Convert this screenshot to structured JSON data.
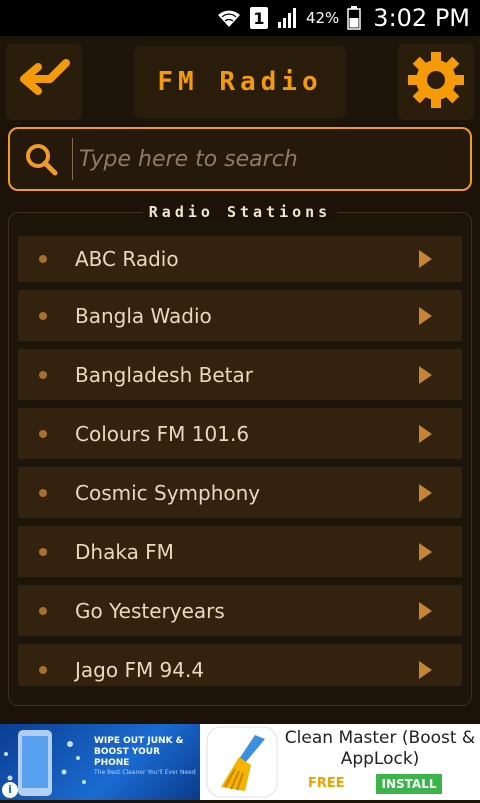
{
  "status_bar": {
    "sim_label": "1",
    "battery_percent": "42%",
    "time": "3:02 PM",
    "icons": [
      "wifi-icon",
      "sim-icon",
      "signal-icon",
      "battery-icon"
    ]
  },
  "header": {
    "title": "FM Radio",
    "back_icon": "back-arrow-icon",
    "settings_icon": "gear-icon"
  },
  "search": {
    "placeholder": "Type here to search",
    "value": "",
    "icon": "search-icon"
  },
  "stations": {
    "section_title": "Radio Stations",
    "items": [
      {
        "label": "ABC Radio"
      },
      {
        "label": "Bangla Wadio"
      },
      {
        "label": "Bangladesh Betar"
      },
      {
        "label": "Colours FM 101.6"
      },
      {
        "label": "Cosmic Symphony"
      },
      {
        "label": "Dhaka FM"
      },
      {
        "label": "Go Yesteryears"
      },
      {
        "label": "Jago FM 94.4"
      }
    ]
  },
  "ad": {
    "banner_headline": "WIPE OUT JUNK & BOOST YOUR PHONE",
    "banner_sub": "The Best Cleaner You'll Ever Need",
    "app_title": "Clean Master (Boost & AppLock)",
    "price": "FREE",
    "install_label": "INSTALL",
    "info_icon": "i"
  },
  "colors": {
    "accent": "#f59a08",
    "background": "#1c1208",
    "row_background": "#33230e",
    "search_border": "#f29a2a",
    "install_green": "#3bb54a"
  }
}
